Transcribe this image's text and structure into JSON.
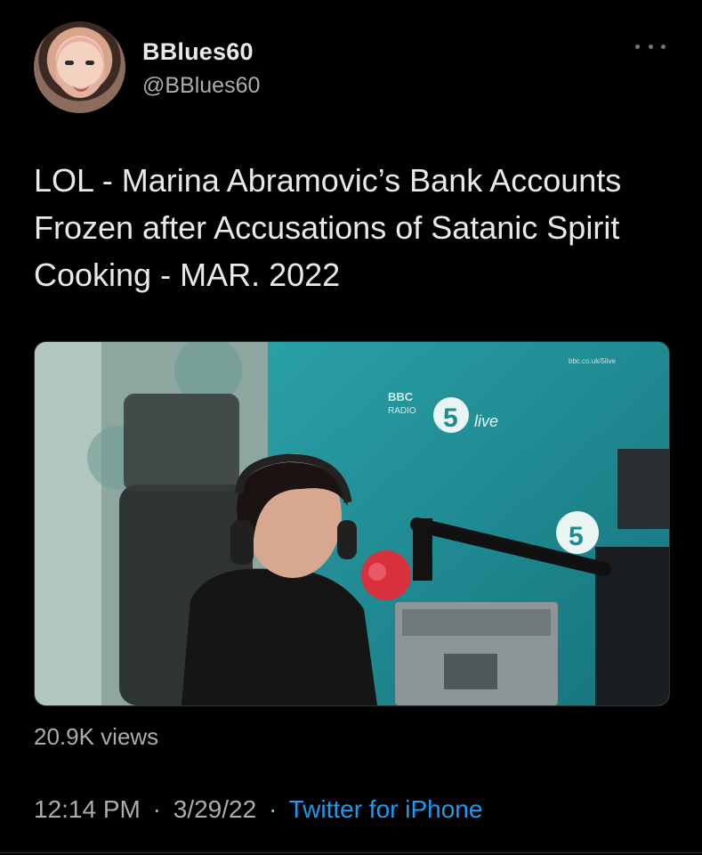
{
  "author": {
    "display_name": "BBlues60",
    "handle": "@BBlues60"
  },
  "tweet": {
    "text": "LOL - Marina Abramovic’s Bank Accounts Frozen after Accusations of Satanic Spirit Cooking - MAR. 2022",
    "views": "20.9K views",
    "time": "12:14 PM",
    "date": "3/29/22",
    "separator": "·",
    "source": "Twitter for iPhone"
  },
  "media": {
    "wall_texts": [
      "BBC",
      "RADIO",
      "5",
      "live",
      "bbc.co.uk/5live"
    ]
  },
  "icons": {
    "more": "more-horizontal-icon"
  },
  "colors": {
    "background": "#000000",
    "primary_text": "#e7e9ea",
    "secondary_text": "#a8adb2",
    "link": "#1d9bf0"
  }
}
